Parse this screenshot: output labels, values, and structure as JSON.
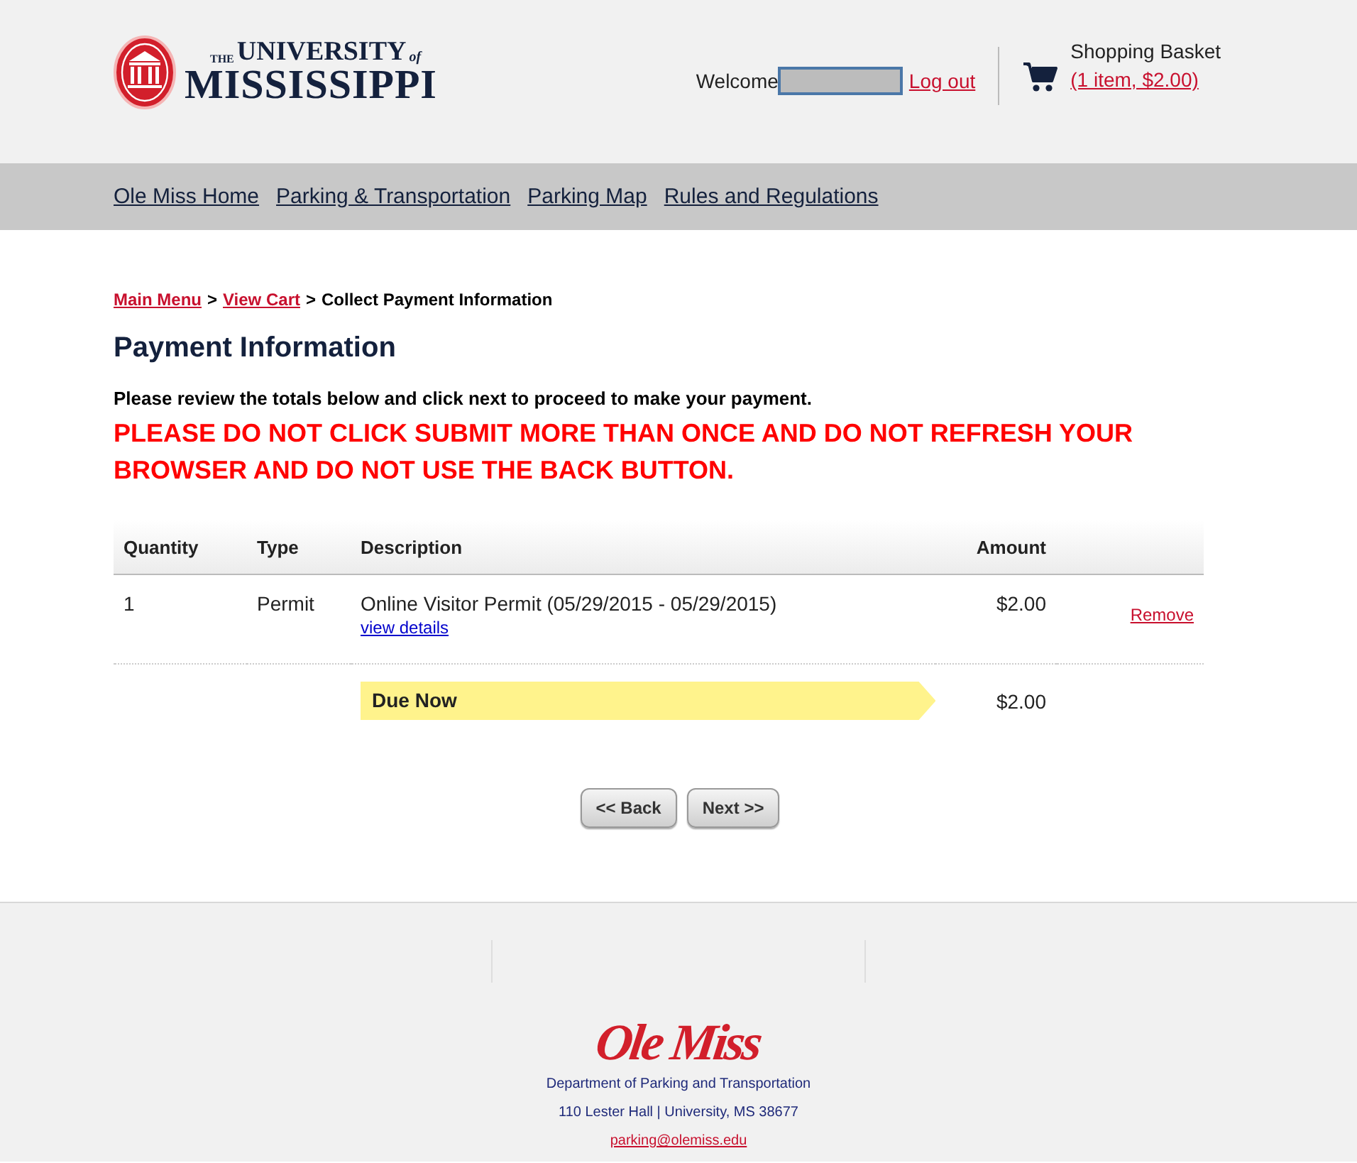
{
  "header": {
    "logo": {
      "the": "THE",
      "university": "UNIVERSITY",
      "of": "of",
      "state": "MISSISSIPPI"
    },
    "welcome": "Welcome",
    "logout": "Log out",
    "basket": {
      "title": "Shopping Basket",
      "summary": "(1 item, $2.00)"
    }
  },
  "nav": [
    "Ole Miss Home",
    "Parking & Transportation",
    "Parking Map",
    "Rules and Regulations"
  ],
  "breadcrumb": {
    "separator": ">",
    "items": [
      {
        "label": "Main Menu",
        "kind": "link"
      },
      {
        "label": "View Cart",
        "kind": "link"
      },
      {
        "label": "Collect Payment Information",
        "kind": "current"
      }
    ]
  },
  "heading": "Payment Information",
  "instructions": "Please review the totals below and click next to proceed to make your payment.",
  "warning": "PLEASE DO NOT CLICK SUBMIT MORE THAN ONCE AND DO NOT REFRESH YOUR BROWSER AND DO NOT USE THE BACK BUTTON.",
  "table": {
    "columns": [
      "Quantity",
      "Type",
      "Description",
      "Amount"
    ],
    "rows": [
      {
        "quantity": "1",
        "type": "Permit",
        "description": "Online Visitor Permit (05/29/2015 - 05/29/2015)",
        "details": "view details",
        "amount": "$2.00",
        "action": "Remove"
      }
    ],
    "total": {
      "label": "Due Now",
      "amount": "$2.00"
    }
  },
  "buttons": [
    "<< Back",
    "Next >>"
  ],
  "footer": {
    "logo": "Ole Miss",
    "department": "Department of Parking and Transportation",
    "address": "110 Lester Hall | University, MS 38677",
    "email": "parking@olemiss.edu"
  }
}
